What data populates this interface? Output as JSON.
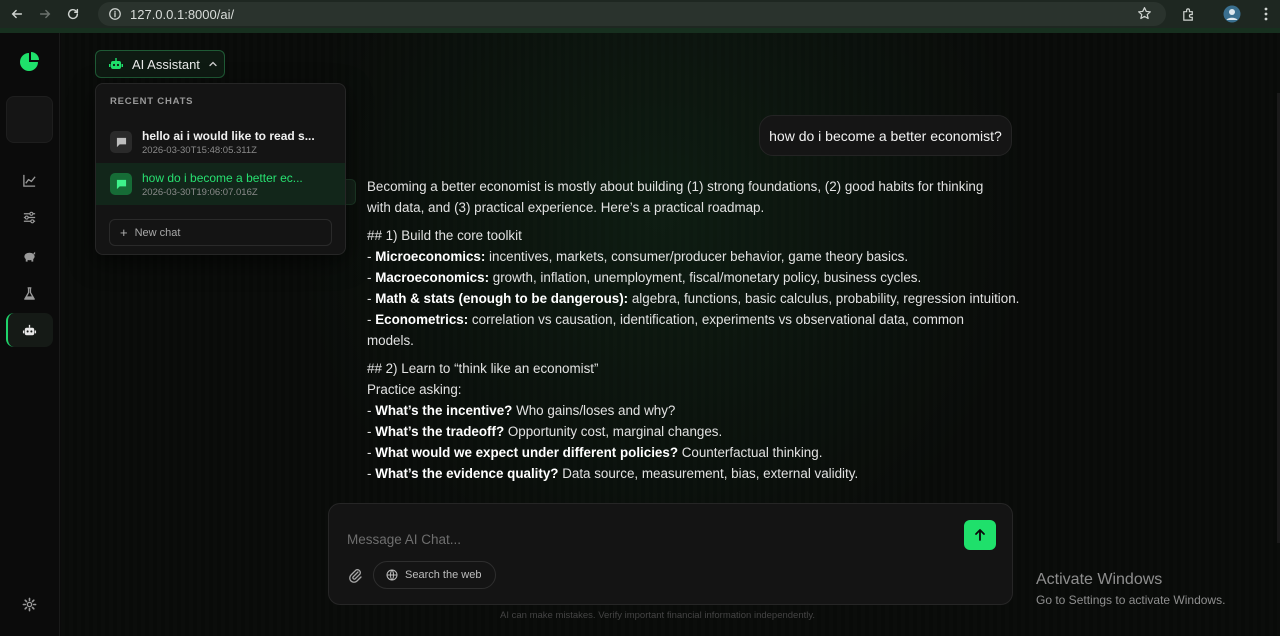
{
  "browser": {
    "url": "127.0.0.1:8000/ai/"
  },
  "header": {
    "assistant_label": "AI Assistant"
  },
  "recent_chats": {
    "heading": "RECENT CHATS",
    "items": [
      {
        "title": "hello ai i would like to read s...",
        "date": "2026-03-30T15:48:05.311Z",
        "active": false
      },
      {
        "title": "how do i become a better ec...",
        "date": "2026-03-30T19:06:07.016Z",
        "active": true
      }
    ],
    "new_chat_label": "New chat"
  },
  "conversation": {
    "user_message": "how do i become a better economist?",
    "answer": {
      "intro_1": "Becoming a better economist is mostly about building (1) strong foundations, (2) good habits for thinking",
      "intro_2": "with data, and (3) practical experience. Here’s a practical roadmap.",
      "section1_heading": "## 1) Build the core toolkit",
      "section1_items": [
        {
          "bold": "Microeconomics:",
          "text": " incentives, markets, consumer/producer behavior, game theory basics."
        },
        {
          "bold": "Macroeconomics:",
          "text": " growth, inflation, unemployment, fiscal/monetary policy, business cycles."
        },
        {
          "bold": "Math & stats (enough to be dangerous):",
          "text": " algebra, functions, basic calculus, probability, regression intuition."
        },
        {
          "bold": "Econometrics:",
          "text": " correlation vs causation, identification, experiments vs observational data, common"
        }
      ],
      "section1_tail": "models.",
      "section2_heading": "## 2) Learn to “think like an economist”",
      "section2_intro": "Practice asking:",
      "section2_items": [
        {
          "bold": "What’s the incentive?",
          "text": " Who gains/loses and why?"
        },
        {
          "bold": "What’s the tradeoff?",
          "text": " Opportunity cost, marginal changes."
        },
        {
          "bold": "What would we expect under different policies?",
          "text": " Counterfactual thinking."
        },
        {
          "bold": "What’s the evidence quality?",
          "text": " Data source, measurement, bias, external validity."
        }
      ]
    }
  },
  "composer": {
    "placeholder": "Message AI Chat...",
    "search_web_label": "Search the web",
    "disclaimer": "AI can make mistakes. Verify important financial information independently."
  },
  "watermark": {
    "title": "Activate Windows",
    "subtitle": "Go to Settings to activate Windows."
  },
  "colors": {
    "accent": "#1fe06b",
    "background": "#0a0a0a"
  }
}
